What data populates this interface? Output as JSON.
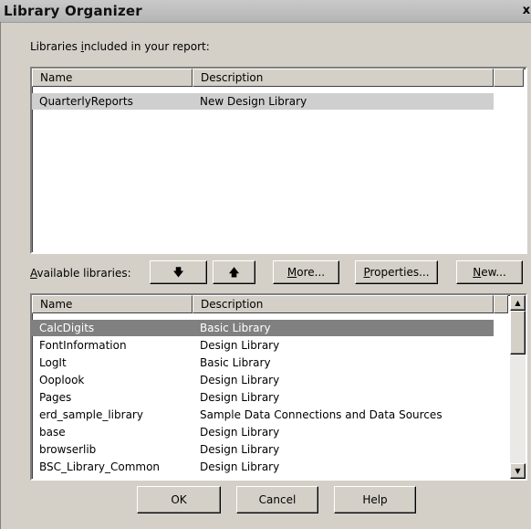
{
  "window": {
    "title": "Library Organizer",
    "close_glyph": "x"
  },
  "included": {
    "label_before": "Libraries ",
    "label_mnemonic": "i",
    "label_after": "ncluded in your report:",
    "columns": [
      "Name",
      "Description"
    ],
    "rows": [
      {
        "name": "QuarterlyReports",
        "description": "New Design Library"
      }
    ]
  },
  "available": {
    "label_mnemonic": "A",
    "label_after": "vailable libraries:",
    "columns": [
      "Name",
      "Description"
    ],
    "rows": [
      {
        "name": "CalcDigits",
        "description": "Basic Library"
      },
      {
        "name": "FontInformation",
        "description": "Design Library"
      },
      {
        "name": "LogIt",
        "description": "Basic Library"
      },
      {
        "name": "Ooplook",
        "description": "Design Library"
      },
      {
        "name": "Pages",
        "description": "Design Library"
      },
      {
        "name": "erd_sample_library",
        "description": "Sample Data Connections and Data Sources"
      },
      {
        "name": "base",
        "description": "Design Library"
      },
      {
        "name": "browserlib",
        "description": "Design Library"
      },
      {
        "name": "BSC_Library_Common",
        "description": "Design Library"
      }
    ]
  },
  "toolbar": {
    "move_down_glyph": "🡇",
    "move_up_glyph": "🡅",
    "more_mnemonic": "M",
    "more_rest": "ore...",
    "properties_mnemonic": "P",
    "properties_rest": "roperties...",
    "new_mnemonic": "N",
    "new_rest": "ew..."
  },
  "footer": {
    "ok": "OK",
    "cancel": "Cancel",
    "help": "Help"
  },
  "icons": {
    "scroll_up": "▲",
    "scroll_down": "▼"
  }
}
